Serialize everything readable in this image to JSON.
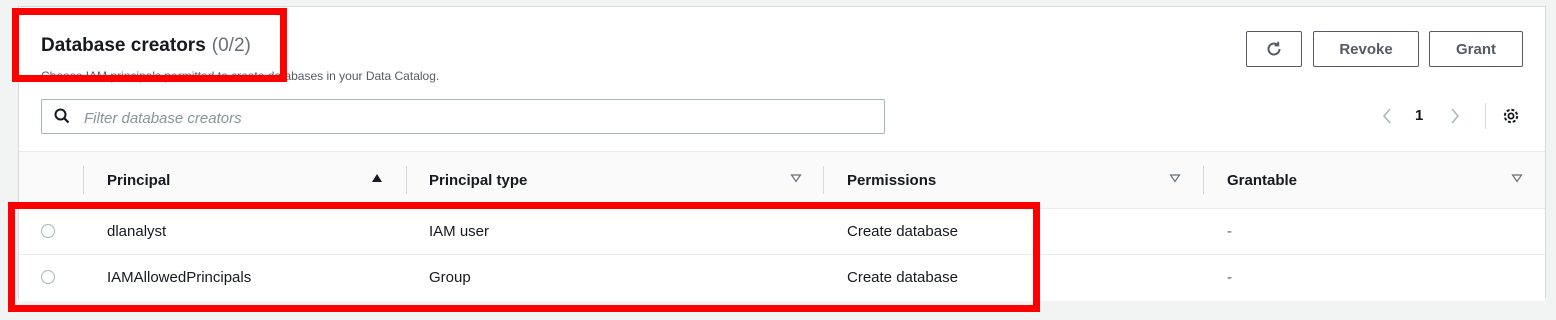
{
  "header": {
    "title": "Database creators",
    "count": "(0/2)",
    "description": "Choose IAM principals permitted to create databases in your Data Catalog."
  },
  "actions": {
    "refresh_icon": "refresh-icon",
    "revoke": "Revoke",
    "grant": "Grant"
  },
  "filter": {
    "placeholder": "Filter database creators",
    "value": ""
  },
  "pagination": {
    "current_page": "1"
  },
  "table": {
    "columns": [
      "Principal",
      "Principal type",
      "Permissions",
      "Grantable"
    ],
    "sort": {
      "column": "Principal",
      "direction": "ascending"
    },
    "rows": [
      {
        "principal": "dlanalyst",
        "principal_type": "IAM user",
        "permissions": "Create database",
        "grantable": "-"
      },
      {
        "principal": "IAMAllowedPrincipals",
        "principal_type": "Group",
        "permissions": "Create database",
        "grantable": "-"
      }
    ]
  },
  "colors": {
    "highlight": "#ff0000",
    "text": "#16191f",
    "muted": "#687078",
    "border": "#d5dbdb"
  }
}
